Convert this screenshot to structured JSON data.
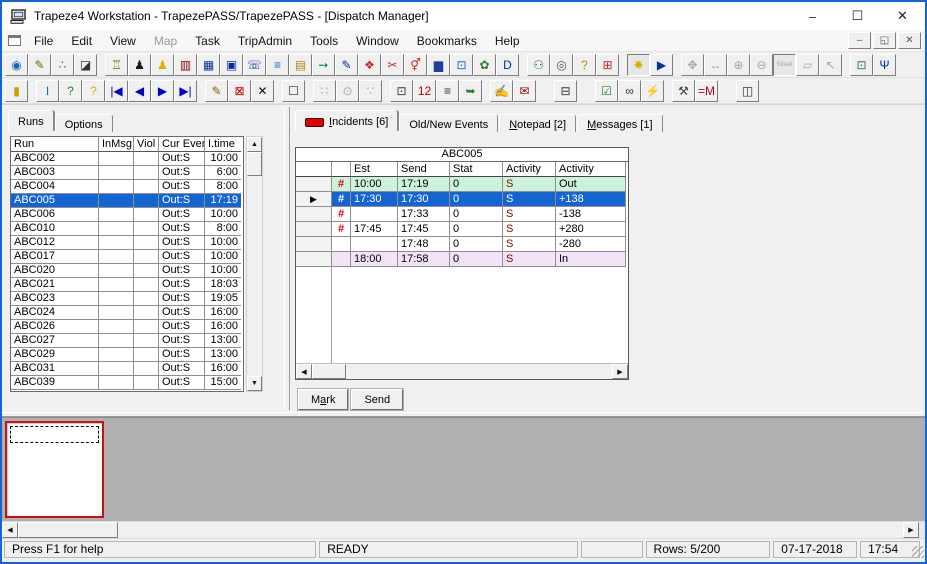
{
  "window": {
    "title": "Trapeze4 Workstation - TrapezePASS/TrapezePASS - [Dispatch Manager]",
    "controls": {
      "minimize": "–",
      "maximize": "☐",
      "close": "✕"
    }
  },
  "mdi_controls": {
    "minimize": "–",
    "restore": "◱",
    "close": "✕"
  },
  "menu": {
    "items": [
      {
        "name": "menu-file",
        "label": "File",
        "cls": ""
      },
      {
        "name": "menu-edit",
        "label": "Edit",
        "cls": ""
      },
      {
        "name": "menu-view",
        "label": "View",
        "cls": ""
      },
      {
        "name": "menu-map",
        "label": "Map",
        "cls": "disabled"
      },
      {
        "name": "menu-task",
        "label": "Task",
        "cls": ""
      },
      {
        "name": "menu-tripadmin",
        "label": "TripAdmin",
        "cls": ""
      },
      {
        "name": "menu-tools",
        "label": "Tools",
        "cls": ""
      },
      {
        "name": "menu-window",
        "label": "Window",
        "cls": ""
      },
      {
        "name": "menu-bookmarks",
        "label": "Bookmarks",
        "cls": ""
      },
      {
        "name": "menu-help",
        "label": "Help",
        "cls": ""
      }
    ]
  },
  "toolbar1": {
    "buttons": [
      {
        "name": "world-icon",
        "glyph": "◉",
        "color": "#1565c0",
        "cls": ""
      },
      {
        "name": "world-edit-icon",
        "glyph": "✎",
        "color": "#806000",
        "cls": ""
      },
      {
        "name": "scatter-edit-icon",
        "glyph": "∴",
        "color": "#c62828",
        "cls": ""
      },
      {
        "name": "map-edit-icon",
        "glyph": "◪",
        "color": "#333333",
        "cls": ""
      },
      {
        "name": "bank-icon",
        "glyph": "♖",
        "color": "#7a5c00",
        "cls": "gap"
      },
      {
        "name": "driver-dark-icon",
        "glyph": "♟",
        "color": "#1a1a1a",
        "cls": ""
      },
      {
        "name": "driver-yellow-icon",
        "glyph": "♟",
        "color": "#d9b300",
        "cls": ""
      },
      {
        "name": "vehicle-icon",
        "glyph": "▥",
        "color": "#8b0000",
        "cls": ""
      },
      {
        "name": "vehicles-icon",
        "glyph": "▦",
        "color": "#00309c",
        "cls": ""
      },
      {
        "name": "vehicle-stop-icon",
        "glyph": "▣",
        "color": "#00309c",
        "cls": ""
      },
      {
        "name": "phone-booking-icon",
        "glyph": "☏",
        "color": "#00309c",
        "cls": ""
      },
      {
        "name": "trip-list-icon",
        "glyph": "≡",
        "color": "#1565c0",
        "cls": ""
      },
      {
        "name": "schedule-cards-icon",
        "glyph": "▤",
        "color": "#b8860b",
        "cls": ""
      },
      {
        "name": "route-arrow-icon",
        "glyph": "➙",
        "color": "#00897b",
        "cls": ""
      },
      {
        "name": "route-draw-icon",
        "glyph": "✎",
        "color": "#00309c",
        "cls": ""
      },
      {
        "name": "blocks-icon",
        "glyph": "❖",
        "color": "#c62828",
        "cls": ""
      },
      {
        "name": "cut-trips-icon",
        "glyph": "✂",
        "color": "#c62828",
        "cls": ""
      },
      {
        "name": "clients-icon",
        "glyph": "⚥",
        "color": "#c62828",
        "cls": ""
      },
      {
        "name": "bus-front-icon",
        "glyph": "▆",
        "color": "#1a3fa0",
        "cls": ""
      },
      {
        "name": "monitor-icon",
        "glyph": "⊡",
        "color": "#1565c0",
        "cls": ""
      },
      {
        "name": "window-new-icon",
        "glyph": "✿",
        "color": "#2e7d32",
        "cls": ""
      },
      {
        "name": "letter-d-icon",
        "glyph": "D",
        "color": "#00309c",
        "cls": ""
      },
      {
        "name": "trace-person-icon",
        "glyph": "⚇",
        "color": "#2e7d32",
        "cls": "gap"
      },
      {
        "name": "locate-person-icon",
        "glyph": "◎",
        "color": "#555555",
        "cls": ""
      },
      {
        "name": "vehicle-query-icon",
        "glyph": "?",
        "color": "#b8860b",
        "cls": ""
      },
      {
        "name": "vehicle-person-icon",
        "glyph": "⊞",
        "color": "#c62828",
        "cls": ""
      },
      {
        "name": "pushpin-icon",
        "glyph": "✸",
        "color": "#d9b300",
        "cls": "gap pressed"
      },
      {
        "name": "window-arrow-icon",
        "glyph": "▶",
        "color": "#00309c",
        "cls": ""
      },
      {
        "name": "pan-move-icon",
        "glyph": "✥",
        "color": "#9a9a9a",
        "cls": "gap disabled"
      },
      {
        "name": "measure-icon",
        "glyph": "↔",
        "color": "#9a9a9a",
        "cls": "disabled"
      },
      {
        "name": "zoom-in-icon",
        "glyph": "⊕",
        "color": "#9a9a9a",
        "cls": "disabled"
      },
      {
        "name": "zoom-out-icon",
        "glyph": "⊖",
        "color": "#9a9a9a",
        "cls": "disabled"
      },
      {
        "name": "street-view-icon",
        "glyph": "Street",
        "color": "#9a9a9a",
        "cls": "disabled pressed small-text"
      },
      {
        "name": "map-flat-icon",
        "glyph": "▱",
        "color": "#9a9a9a",
        "cls": "disabled"
      },
      {
        "name": "pointer-icon",
        "glyph": "↖",
        "color": "#9a9a9a",
        "cls": "disabled"
      },
      {
        "name": "avl-monitor-icon",
        "glyph": "⊡",
        "color": "#2e7d32",
        "cls": "gap"
      },
      {
        "name": "vehicle-comm-icon",
        "glyph": "Ψ",
        "color": "#00309c",
        "cls": ""
      }
    ]
  },
  "toolbar2": {
    "buttons": [
      {
        "name": "exit-door-icon",
        "glyph": "▮",
        "color": "#c8a000",
        "cls": ""
      },
      {
        "name": "run-info-icon",
        "glyph": "I",
        "color": "#1565c0",
        "cls": "gap"
      },
      {
        "name": "vehicle-find-icon",
        "glyph": "?",
        "color": "#2e7d32",
        "cls": ""
      },
      {
        "name": "help-icon",
        "glyph": "?",
        "color": "#d9b300",
        "cls": ""
      },
      {
        "name": "nav-first-icon",
        "glyph": "|◀",
        "color": "#0000cc",
        "cls": ""
      },
      {
        "name": "nav-prev-icon",
        "glyph": "◀",
        "color": "#0000cc",
        "cls": ""
      },
      {
        "name": "nav-next-icon",
        "glyph": "▶",
        "color": "#0000cc",
        "cls": ""
      },
      {
        "name": "nav-last-icon",
        "glyph": "▶|",
        "color": "#0000cc",
        "cls": ""
      },
      {
        "name": "edit-icon",
        "glyph": "✎",
        "color": "#806000",
        "cls": "gap"
      },
      {
        "name": "cancel-incident-icon",
        "glyph": "⊠",
        "color": "#c00000",
        "cls": ""
      },
      {
        "name": "delete-icon",
        "glyph": "✕",
        "color": "#111111",
        "cls": ""
      },
      {
        "name": "new-document-icon",
        "glyph": "☐",
        "color": "#333333",
        "cls": "gap"
      },
      {
        "name": "options-dots-icon",
        "glyph": "∷",
        "color": "#9a9a9a",
        "cls": "gap disabled"
      },
      {
        "name": "find-icon",
        "glyph": "⊙",
        "color": "#9a9a9a",
        "cls": "disabled"
      },
      {
        "name": "footprints-icon",
        "glyph": "∵",
        "color": "#9a9a9a",
        "cls": "disabled"
      },
      {
        "name": "avl-status-icon",
        "glyph": "⊡",
        "color": "#333333",
        "cls": "gap"
      },
      {
        "name": "clock-12-icon",
        "glyph": "12",
        "color": "#c00000",
        "cls": ""
      },
      {
        "name": "times-list-icon",
        "glyph": "≡",
        "color": "#333333",
        "cls": ""
      },
      {
        "name": "note-send-icon",
        "glyph": "➥",
        "color": "#2e7d32",
        "cls": ""
      },
      {
        "name": "no-show-icon",
        "glyph": "✍",
        "color": "#c00000",
        "cls": "gap"
      },
      {
        "name": "mail-send-icon",
        "glyph": "✉",
        "color": "#8b0000",
        "cls": ""
      },
      {
        "name": "print-icon",
        "glyph": "⊟",
        "color": "#333333",
        "cls": "gap wide"
      },
      {
        "name": "checklist-icon",
        "glyph": "☑",
        "color": "#2e7d32",
        "cls": "gap wide"
      },
      {
        "name": "link-icon",
        "glyph": "∞",
        "color": "#333333",
        "cls": ""
      },
      {
        "name": "link-broken-icon",
        "glyph": "⚡",
        "color": "#333333",
        "cls": ""
      },
      {
        "name": "vehicle-tools-icon",
        "glyph": "⚒",
        "color": "#444444",
        "cls": "gap"
      },
      {
        "name": "equals-m-icon",
        "glyph": "=M",
        "color": "#b00020",
        "cls": ""
      },
      {
        "name": "manual-icon",
        "glyph": "◫",
        "color": "#333333",
        "cls": "gap wide"
      }
    ]
  },
  "left_panel": {
    "tabs": [
      {
        "name": "tab-runs",
        "label": "Runs",
        "cls": "active"
      },
      {
        "name": "tab-options",
        "label": "Options",
        "cls": ""
      }
    ],
    "table": {
      "columns": [
        "Run",
        "InMsg",
        "Viol",
        "Cur Event",
        "I.time"
      ],
      "rows": [
        {
          "run": "ABC002",
          "inmsg": "",
          "viol": "",
          "cur": "Out:S",
          "itime": "10:00",
          "cls": ""
        },
        {
          "run": "ABC003",
          "inmsg": "",
          "viol": "",
          "cur": "Out:S",
          "itime": "6:00",
          "cls": ""
        },
        {
          "run": "ABC004",
          "inmsg": "",
          "viol": "",
          "cur": "Out:S",
          "itime": "8:00",
          "cls": ""
        },
        {
          "run": "ABC005",
          "inmsg": "",
          "viol": "",
          "cur": "Out:S",
          "itime": "17:19",
          "cls": "selected"
        },
        {
          "run": "ABC006",
          "inmsg": "",
          "viol": "",
          "cur": "Out:S",
          "itime": "10:00",
          "cls": ""
        },
        {
          "run": "ABC010",
          "inmsg": "",
          "viol": "",
          "cur": "Out:S",
          "itime": "8:00",
          "cls": ""
        },
        {
          "run": "ABC012",
          "inmsg": "",
          "viol": "",
          "cur": "Out:S",
          "itime": "10:00",
          "cls": ""
        },
        {
          "run": "ABC017",
          "inmsg": "",
          "viol": "",
          "cur": "Out:S",
          "itime": "10:00",
          "cls": ""
        },
        {
          "run": "ABC020",
          "inmsg": "",
          "viol": "",
          "cur": "Out:S",
          "itime": "10:00",
          "cls": ""
        },
        {
          "run": "ABC021",
          "inmsg": "",
          "viol": "",
          "cur": "Out:S",
          "itime": "18:03",
          "cls": ""
        },
        {
          "run": "ABC023",
          "inmsg": "",
          "viol": "",
          "cur": "Out:S",
          "itime": "19:05",
          "cls": ""
        },
        {
          "run": "ABC024",
          "inmsg": "",
          "viol": "",
          "cur": "Out:S",
          "itime": "16:00",
          "cls": ""
        },
        {
          "run": "ABC026",
          "inmsg": "",
          "viol": "",
          "cur": "Out:S",
          "itime": "16:00",
          "cls": ""
        },
        {
          "run": "ABC027",
          "inmsg": "",
          "viol": "",
          "cur": "Out:S",
          "itime": "13:00",
          "cls": ""
        },
        {
          "run": "ABC029",
          "inmsg": "",
          "viol": "",
          "cur": "Out:S",
          "itime": "13:00",
          "cls": ""
        },
        {
          "run": "ABC031",
          "inmsg": "",
          "viol": "",
          "cur": "Out:S",
          "itime": "16:00",
          "cls": ""
        },
        {
          "run": "ABC039",
          "inmsg": "",
          "viol": "",
          "cur": "Out:S",
          "itime": "15:00",
          "cls": ""
        }
      ]
    }
  },
  "right_panel": {
    "tabs": [
      {
        "name": "tab-incidents",
        "pre": "",
        "u": "I",
        "post": "ncidents [6]",
        "led": "led",
        "cls": "active"
      },
      {
        "name": "tab-old-new-events",
        "pre": "Old/New Events",
        "u": "",
        "post": "",
        "led": "",
        "cls": ""
      },
      {
        "name": "tab-notepad",
        "pre": "",
        "u": "N",
        "post": "otepad [2]",
        "led": "",
        "cls": ""
      },
      {
        "name": "tab-messages",
        "pre": "",
        "u": "M",
        "post": "essages [1]",
        "led": "",
        "cls": ""
      }
    ],
    "grid": {
      "title": "ABC005",
      "columns": [
        "",
        "",
        "Est",
        "Send",
        "Stat",
        "Activity",
        "Activity"
      ],
      "rows": [
        {
          "sel": "",
          "hash": "#",
          "est": "10:00",
          "send": "17:19",
          "stat": "0",
          "act": "S",
          "act2": "Out",
          "cls": "row-green"
        },
        {
          "sel": "▶",
          "hash": "#",
          "est": "17:30",
          "send": "17:30",
          "stat": "0",
          "act": "S",
          "act2": "+138",
          "cls": "row-selected"
        },
        {
          "sel": "",
          "hash": "#",
          "est": "",
          "send": "17:33",
          "stat": "0",
          "act": "S",
          "act2": "-138",
          "cls": ""
        },
        {
          "sel": "",
          "hash": "#",
          "est": "17:45",
          "send": "17:45",
          "stat": "0",
          "act": "S",
          "act2": "+280",
          "cls": ""
        },
        {
          "sel": "",
          "hash": "",
          "est": "",
          "send": "17:48",
          "stat": "0",
          "act": "S",
          "act2": "-280",
          "cls": ""
        },
        {
          "sel": "",
          "hash": "",
          "est": "18:00",
          "send": "17:58",
          "stat": "0",
          "act": "S",
          "act2": "In",
          "cls": "row-pink"
        }
      ]
    },
    "actions": {
      "mark": {
        "pre": "M",
        "u": "a",
        "post": "rk"
      },
      "send": {
        "pre": "Send",
        "u": "",
        "post": ""
      }
    }
  },
  "statusbar": {
    "help": "Press F1 for help",
    "ready": "READY",
    "rows": "Rows: 5/200",
    "date": "07-17-2018",
    "time": "17:54"
  },
  "colors": {
    "frame_blue": "#1464d2",
    "selection_blue": "#1464d2",
    "incident_row_green": "#cdf2da",
    "incident_row_pink": "#f3e3f7",
    "alert_red": "#e00000",
    "activity_maroon": "#8b0000",
    "incident_led_red": "#e00000",
    "thumbnail_border_red": "#cc1111"
  }
}
